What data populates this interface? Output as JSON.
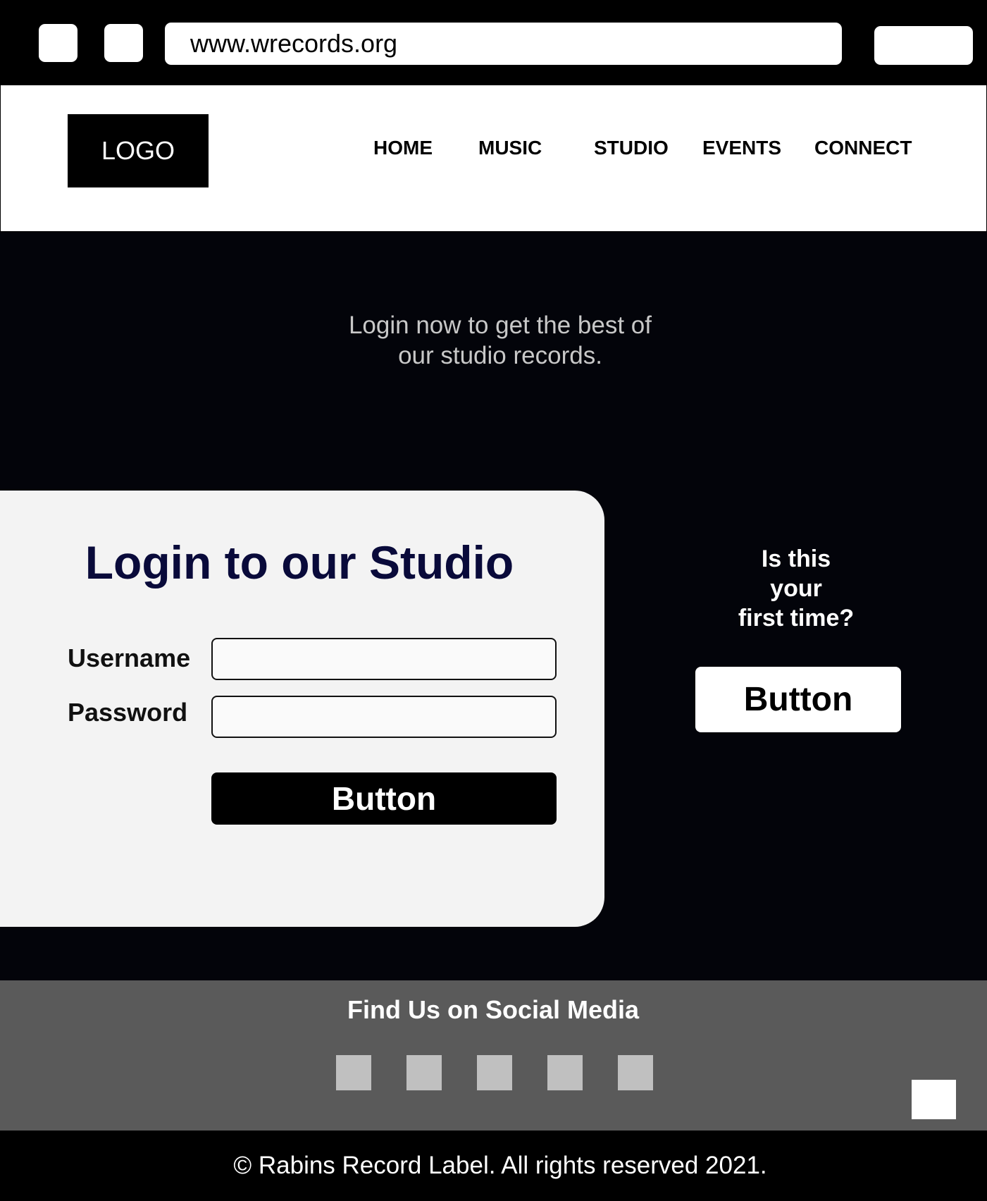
{
  "browser": {
    "address": "www.wrecords.org"
  },
  "header": {
    "logo": "LOGO",
    "nav": [
      "HOME",
      "MUSIC",
      "STUDIO",
      "EVENTS",
      "CONNECT"
    ]
  },
  "hero": {
    "tagline_line1": "Login now to get the best of",
    "tagline_line2": "our studio records."
  },
  "login": {
    "title": "Login to our Studio",
    "username_label": "Username",
    "username_value": "",
    "password_label": "Password",
    "password_value": "",
    "button_label": "Button"
  },
  "first_time": {
    "line1": "Is this",
    "line2": "your",
    "line3": "first time?",
    "button_label": "Button"
  },
  "social": {
    "title": "Find Us on Social Media",
    "icon_count": 5
  },
  "footer": {
    "copyright": "© Rabins Record Label. All rights reserved 2021."
  },
  "colors": {
    "hero_background": "#03040a",
    "card_background": "#f3f3f3",
    "title_color": "#090a3a",
    "social_band": "#5a5a5a",
    "social_icon": "#c0c0c0"
  }
}
